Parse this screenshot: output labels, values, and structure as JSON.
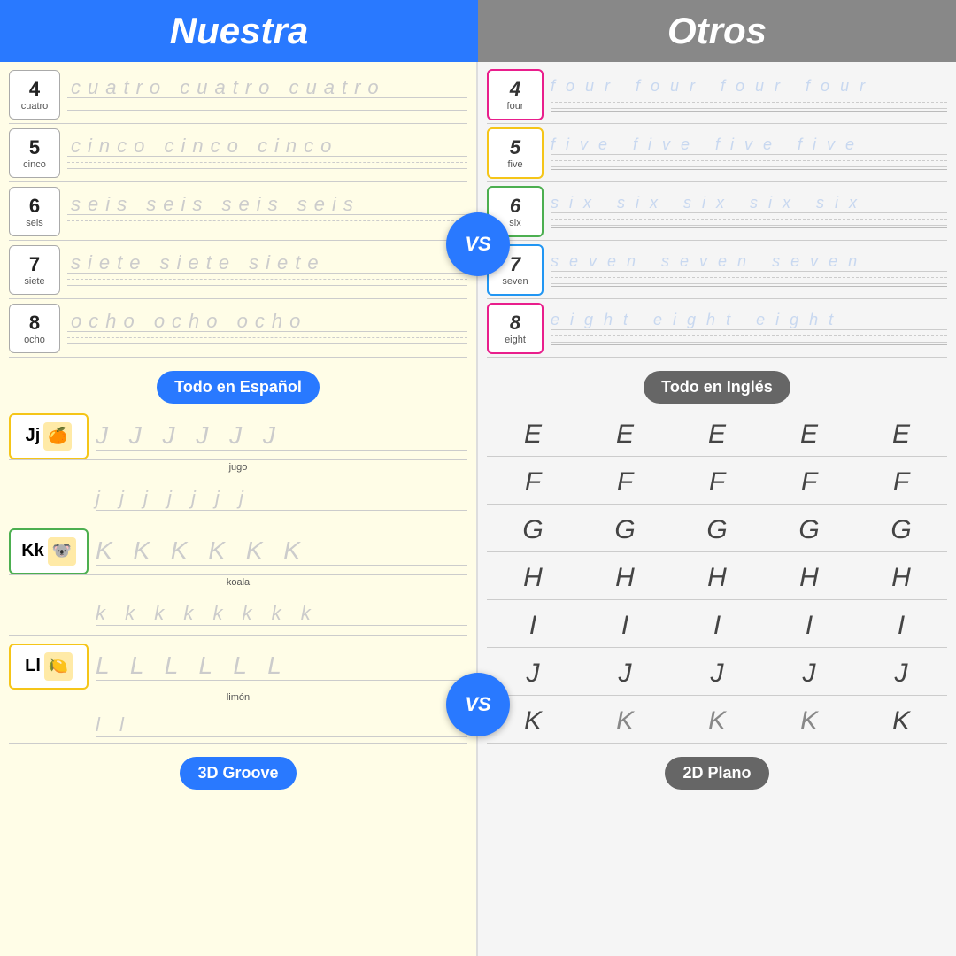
{
  "header": {
    "left_title": "Nuestra",
    "right_title": "Otros"
  },
  "vs_label": "VS",
  "left": {
    "numbers": [
      {
        "digit": "4",
        "label": "cuatro",
        "trace": "cuatro  cuatro  cuatro"
      },
      {
        "digit": "5",
        "label": "cinco",
        "trace": "cinco  cinco  cinco"
      },
      {
        "digit": "6",
        "label": "seis",
        "trace": "seis  seis  seis  seis"
      },
      {
        "digit": "7",
        "label": "siete",
        "trace": "siete  siete  siete"
      },
      {
        "digit": "8",
        "label": "ocho",
        "trace": "ocho  ocho  ocho"
      }
    ],
    "cta_numbers": "Todo en Español",
    "letters": [
      {
        "upper": "J",
        "lower": "j",
        "word": "jugo",
        "icon": "🍊",
        "trace_upper": "J  J  J  J  J  J",
        "trace_lower": "j   j   j   j   j   j   j"
      },
      {
        "upper": "K",
        "lower": "k",
        "word": "koala",
        "icon": "🐨",
        "trace_upper": "K  K  K  K  K  K",
        "trace_lower": "k  k  k  k  k  k  k  k"
      },
      {
        "upper": "L",
        "lower": "l",
        "word": "limón",
        "icon": "🍋",
        "trace_upper": "L  L  L  L  L  L",
        "trace_lower": "l  l"
      }
    ],
    "cta_letters": "3D Groove"
  },
  "right": {
    "numbers": [
      {
        "digit": "4",
        "script": "4",
        "label": "four",
        "color": "pink",
        "trace": "four  four  four  four"
      },
      {
        "digit": "5",
        "script": "5",
        "label": "five",
        "color": "yellow",
        "trace": "five  five  five  five"
      },
      {
        "digit": "6",
        "script": "6",
        "label": "six",
        "color": "green",
        "trace": "six  six  six  six  six"
      },
      {
        "digit": "7",
        "script": "7",
        "label": "seven",
        "color": "blue",
        "trace": "seven  seven  seven"
      },
      {
        "digit": "8",
        "script": "8",
        "label": "eight",
        "color": "pink",
        "trace": "eight  eight  eight"
      }
    ],
    "cta_numbers": "Todo en Inglés",
    "letters": [
      "E",
      "F",
      "G",
      "H",
      "I",
      "J",
      "K"
    ],
    "cta_letters": "2D Plano"
  }
}
